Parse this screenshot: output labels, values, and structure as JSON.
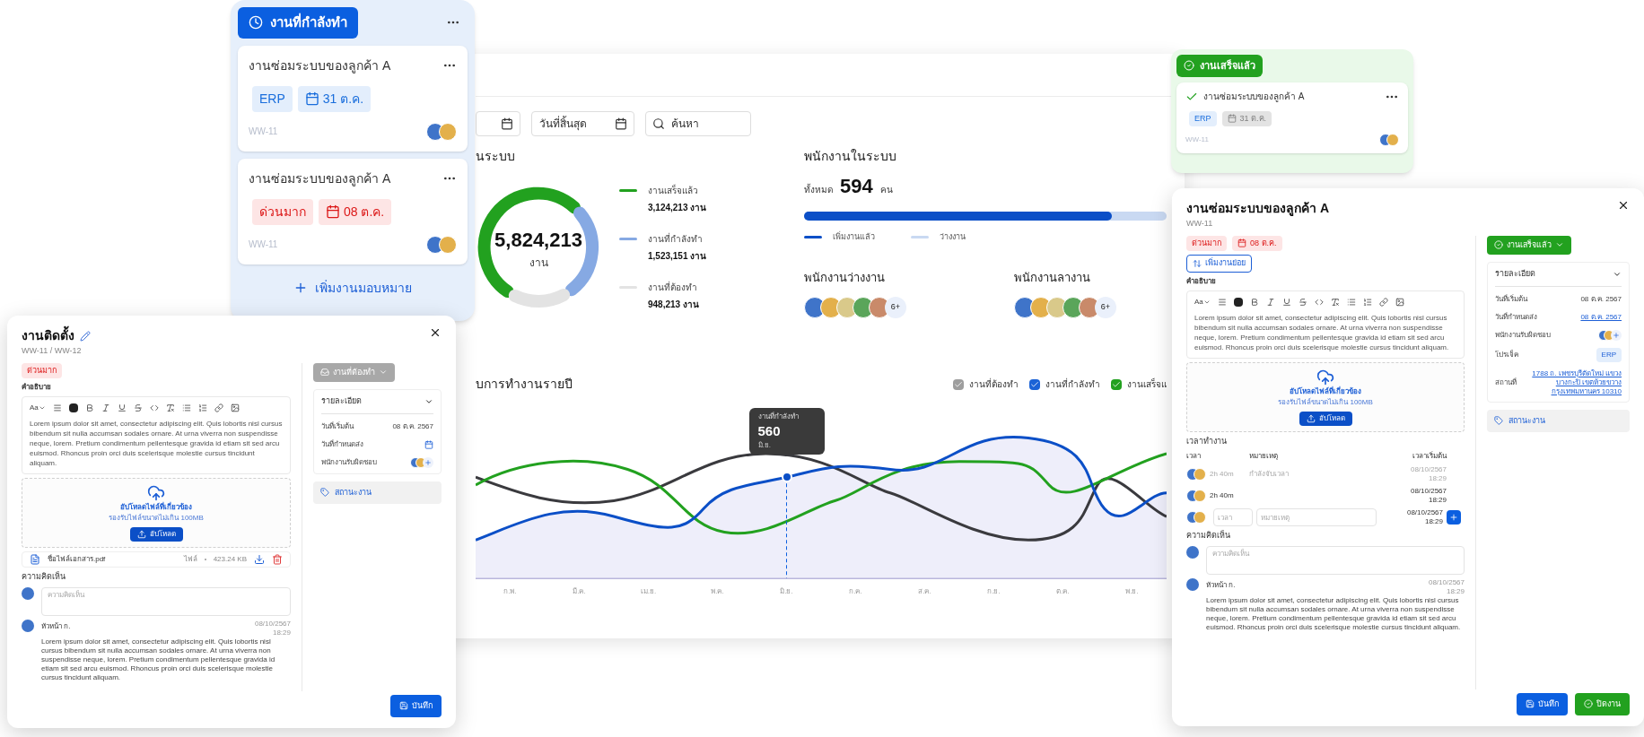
{
  "dashboard": {
    "filters": [
      {
        "kind": "date",
        "placeholder": "วันที่สิ้นสุด"
      },
      {
        "kind": "search",
        "placeholder": "ค้นหา"
      }
    ],
    "tasks_summary": {
      "title": "นระบบ",
      "total": "5,824,213",
      "unit": "งาน",
      "legend": [
        {
          "label": "งานเสร็จแล้ว",
          "value": "3,124,213 งาน",
          "color": "#22a11f"
        },
        {
          "label": "งานที่กำลังทำ",
          "value": "1,523,151 งาน",
          "color": "#86a9e3"
        },
        {
          "label": "งานที่ต้องทำ",
          "value": "948,213 งาน",
          "color": "#e3e3e3"
        }
      ]
    },
    "employees": {
      "title": "พนักงานในระบบ",
      "total_label": "ทั้งหมด",
      "count": "594",
      "unit": "คน",
      "level": 0.85,
      "legend": [
        {
          "label": "เพิ่มงานแล้ว",
          "kind": "assigned"
        },
        {
          "label": "ว่างงาน",
          "kind": "free"
        }
      ],
      "groups": [
        {
          "title": "พนักงานว่างงาน",
          "more": "6+"
        },
        {
          "title": "พนักงานลางาน",
          "more": "6+"
        }
      ]
    },
    "yearly_chart": {
      "title": "บการทำงานรายปี",
      "legend": [
        {
          "label": "งานที่ต้องทำ",
          "checked": true,
          "color": "#9e9e9e"
        },
        {
          "label": "งานที่กำลังทำ",
          "checked": true,
          "color": "#1b63d6"
        },
        {
          "label": "งานเสร็จแ",
          "checked": true,
          "color": "#22a11f"
        }
      ],
      "months": [
        "ก.พ.",
        "มี.ค.",
        "เม.ย.",
        "พ.ค.",
        "มิ.ย.",
        "ก.ค.",
        "ส.ค.",
        "ก.ย.",
        "ต.ค.",
        "พ.ย."
      ],
      "tooltip": {
        "label": "งานที่กำลังทำ",
        "value": "560",
        "month": "มิ.ย."
      }
    }
  },
  "kanban_column": {
    "title": "งานที่กำลังทำ",
    "cards": [
      {
        "title": "งานซ่อมระบบของลูกค้า A",
        "done": false,
        "tags": [
          {
            "kind": "label",
            "color": "#e3eefc",
            "label": "ERP"
          },
          {
            "kind": "date",
            "color": "#e3eefc",
            "label": "31 ต.ค."
          }
        ],
        "code": "WW-11"
      },
      {
        "title": "งานซ่อมระบบของลูกค้า A",
        "done": false,
        "tags": [
          {
            "kind": "label",
            "color": "#fde5e5",
            "label": "ด่วนมาก"
          },
          {
            "kind": "date",
            "color": "#fde5e5",
            "label": "08 ต.ค."
          }
        ],
        "code": "WW-11"
      }
    ],
    "add_label": "เพิ่มงานมอบหมาย"
  },
  "done_column": {
    "title": "งานเสร็จแล้ว",
    "card": {
      "title": "งานซ่อมระบบของลูกค้า A",
      "done": true,
      "tags": [
        {
          "kind": "label",
          "color": "#e3eefc",
          "label": "ERP"
        },
        {
          "kind": "date",
          "color": "#e3e3e3",
          "label": "31 ต.ค."
        }
      ],
      "code": "WW-11"
    }
  },
  "task_dialogs": [
    {
      "title": "งานติดตั้ง",
      "editable": true,
      "code": "WW-11 / WW-12",
      "tags": [
        {
          "kind": "label",
          "color": "#fde5e5",
          "label": "ด่วนมาก"
        }
      ],
      "description_label": "คำอธิบาย",
      "editor": {
        "font": "Aa",
        "text": "Lorem ipsum dolor sit amet, consectetur adipiscing elit. Quis lobortis nisl cursus bibendum sit nulla accumsan sodales ornare. At urna viverra non suspendisse neque, lorem. Pretium condimentum pellentesque gravida id etiam sit sed arcu euismod. Rhoncus proin orci duis scelerisque molestie cursus tincidunt aliquam."
      },
      "upload": {
        "title": "อัปโหลดไฟล์ที่เกี่ยวข้อง",
        "hint": "รองรับไฟล์ขนาดไม่เกิน 100MB",
        "button": "อัปโหลด"
      },
      "files": [
        {
          "name": "ชื่อไฟล์เอกสาร.pdf",
          "type": "ไฟล์",
          "size": "423.24 KB"
        }
      ],
      "comments_label": "ความคิดเห็น",
      "comment_placeholder": "ความคิดเห็น",
      "comments": [
        {
          "author": "หัวหน้า ก.",
          "date": "08/10/2567",
          "time": "18:29",
          "text": "Lorem ipsum dolor sit amet, consectetur adipiscing elit. Quis lobortis nisl cursus bibendum sit nulla accumsan sodales ornare. At urna viverra non suspendisse neque, lorem. Pretium condimentum pellentesque gravida id etiam sit sed arcu euismod. Rhoncus proin orci duis scelerisque molestie cursus tincidunt aliquam."
        }
      ],
      "status": {
        "label": "งานที่ต้องทำ",
        "kind": "todo",
        "color": "#a8a8a8"
      },
      "details": {
        "title": "รายละเอียด",
        "expanded": true,
        "rows": [
          {
            "kind": "text",
            "label": "วันที่เริ่มต้น",
            "value": "08 ต.ค. 2567"
          },
          {
            "kind": "calendar",
            "label": "วันที่กำหนดส่ง"
          },
          {
            "kind": "avatars",
            "label": "พนักงานรับผิดชอบ"
          }
        ]
      },
      "tag_button": "สถานะงาน",
      "actions": [
        {
          "kind": "save",
          "label": "บันทึก"
        }
      ]
    },
    {
      "title": "งานซ่อมระบบของลูกค้า A",
      "editable": false,
      "code": "WW-11",
      "tags": [
        {
          "kind": "label",
          "color": "#fde5e5",
          "label": "ด่วนมาก"
        },
        {
          "kind": "date",
          "color": "#fde5e5",
          "label": "08 ต.ค."
        }
      ],
      "subtask_button": "เพิ่มงานย่อย",
      "description_label": "คำอธิบาย",
      "editor": {
        "font": "Aa",
        "text": "Lorem ipsum dolor sit amet, consectetur adipiscing elit. Quis lobortis nisl cursus bibendum sit nulla accumsan sodales ornare. At urna viverra non suspendisse neque, lorem. Pretium condimentum pellentesque gravida id etiam sit sed arcu euismod. Rhoncus proin orci duis scelerisque molestie cursus tincidunt aliquam."
      },
      "upload": {
        "title": "อัปโหลดไฟล์ที่เกี่ยวข้อง",
        "hint": "รองรับไฟล์ขนาดไม่เกิน 100MB",
        "button": "อัปโหลด"
      },
      "worklog": {
        "title": "เวลาทำงาน",
        "columns": [
          "เวลา",
          "หมายเหตุ",
          "เวลาเริ่มต้น"
        ],
        "rows": [
          {
            "kind": "running",
            "duration": "2h 40m",
            "note": "กำลังจับเวลา",
            "date": "08/10/2567",
            "time": "18:29"
          },
          {
            "kind": "done",
            "duration": "2h 40m",
            "date": "08/10/2567",
            "time": "18:29"
          }
        ],
        "new_entry": {
          "time_placeholder": "เวลา",
          "note_placeholder": "หมายเหตุ",
          "date": "08/10/2567",
          "time": "18:29"
        }
      },
      "comments_label": "ความคิดเห็น",
      "comment_placeholder": "ความคิดเห็น",
      "comments": [
        {
          "author": "หัวหน้า ก.",
          "date": "08/10/2567",
          "time": "18:29",
          "text": "Lorem ipsum dolor sit amet, consectetur adipiscing elit. Quis lobortis nisl cursus bibendum sit nulla accumsan sodales ornare. At urna viverra non suspendisse neque, lorem. Pretium condimentum pellentesque gravida id etiam sit sed arcu euismod. Rhoncus proin orci duis scelerisque molestie cursus tincidunt aliquam."
        }
      ],
      "status": {
        "label": "งานเสร็จแล้ว",
        "kind": "done",
        "color": "#22a11f"
      },
      "details": {
        "title": "รายละเอียด",
        "expanded": true,
        "rows": [
          {
            "kind": "text",
            "label": "วันที่เริ่มต้น",
            "value": "08 ต.ค. 2567"
          },
          {
            "kind": "link",
            "label": "วันที่กำหนดส่ง",
            "value": "08 ต.ค. 2567"
          },
          {
            "kind": "avatars",
            "label": "พนักงานรับผิดชอบ"
          },
          {
            "kind": "tag",
            "label": "โปรเจ็ค",
            "value": "ERP"
          },
          {
            "kind": "link",
            "label": "สถานที่",
            "value": "1788 ถ. เพชรบุรีตัดใหม่ แขวงบางกะปิ เขตห้วยขวาง กรุงเทพมหานคร 10310"
          }
        ]
      },
      "tag_button": "สถานะงาน",
      "actions": [
        {
          "kind": "save",
          "label": "บันทึก"
        },
        {
          "kind": "close",
          "label": "ปิดงาน"
        }
      ]
    }
  ]
}
